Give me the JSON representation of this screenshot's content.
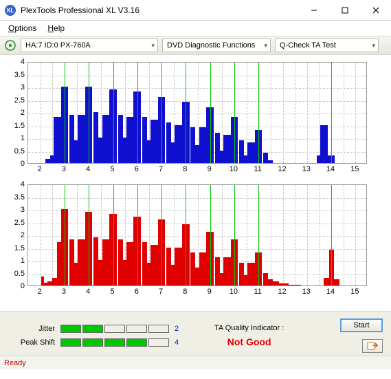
{
  "titlebar": {
    "app_icon_text": "XL",
    "title": "PlexTools Professional XL V3.16"
  },
  "menubar": {
    "options": "Options",
    "help": "Help"
  },
  "toolbar": {
    "drive": "HA:7 ID:0   PX-760A",
    "mode": "DVD Diagnostic Functions",
    "test": "Q-Check TA Test"
  },
  "footer": {
    "jitter_label": "Jitter",
    "jitter_value": "2",
    "peakshift_label": "Peak Shift",
    "peakshift_value": "4",
    "quality_title": "TA Quality Indicator :",
    "quality_value": "Not Good",
    "start_label": "Start"
  },
  "statusbar": {
    "text": "Ready"
  },
  "chart_data": [
    {
      "type": "area",
      "color": "#1010d0",
      "xlabel": "",
      "ylabel": "",
      "x_ticks": [
        2,
        3,
        4,
        5,
        6,
        7,
        8,
        9,
        10,
        11,
        12,
        13,
        14,
        15
      ],
      "y_ticks": [
        0,
        0.5,
        1,
        1.5,
        2,
        2.5,
        3,
        3.5,
        4
      ],
      "xlim": [
        1.5,
        15.5
      ],
      "ylim": [
        0,
        4
      ],
      "green_lines": [
        3,
        4,
        5,
        6,
        7,
        8,
        9,
        10,
        11,
        14
      ],
      "x": [
        2,
        2.1,
        2.3,
        2.5,
        2.7,
        3,
        3.3,
        3.5,
        3.7,
        4,
        4.3,
        4.5,
        4.7,
        5,
        5.3,
        5.5,
        5.7,
        6,
        6.3,
        6.5,
        6.7,
        7,
        7.3,
        7.5,
        7.7,
        8,
        8.3,
        8.5,
        8.7,
        9,
        9.3,
        9.5,
        9.7,
        10,
        10.3,
        10.5,
        10.7,
        11,
        11.3,
        11.5,
        11.7,
        12,
        12.5,
        13,
        13.5,
        13.7,
        14,
        14.3,
        14.5,
        15
      ],
      "values": [
        0,
        0,
        0.15,
        0.3,
        1.8,
        3.0,
        1.9,
        0.9,
        1.9,
        3.0,
        2.0,
        1.0,
        1.9,
        2.9,
        1.9,
        1.0,
        1.8,
        2.8,
        1.8,
        0.9,
        1.7,
        2.6,
        1.6,
        0.8,
        1.5,
        2.4,
        1.4,
        0.7,
        1.4,
        2.2,
        1.2,
        0.5,
        1.1,
        1.8,
        0.9,
        0.3,
        0.8,
        1.3,
        0.4,
        0.1,
        0,
        0,
        0,
        0,
        0.3,
        1.5,
        0.3,
        0,
        0,
        0
      ]
    },
    {
      "type": "area",
      "color": "#e00000",
      "xlabel": "",
      "ylabel": "",
      "x_ticks": [
        2,
        3,
        4,
        5,
        6,
        7,
        8,
        9,
        10,
        11,
        12,
        13,
        14,
        15
      ],
      "y_ticks": [
        0,
        0.5,
        1,
        1.5,
        2,
        2.5,
        3,
        3.5,
        4
      ],
      "xlim": [
        1.5,
        15.5
      ],
      "ylim": [
        0,
        4
      ],
      "green_lines": [
        3,
        4,
        5,
        6,
        7,
        8,
        9,
        10,
        11,
        14
      ],
      "x": [
        2,
        2.1,
        2.2,
        2.4,
        2.6,
        2.8,
        3,
        3.3,
        3.5,
        3.7,
        4,
        4.3,
        4.5,
        4.7,
        5,
        5.3,
        5.5,
        5.7,
        6,
        6.3,
        6.5,
        6.7,
        7,
        7.3,
        7.5,
        7.7,
        8,
        8.3,
        8.5,
        8.7,
        9,
        9.3,
        9.5,
        9.7,
        10,
        10.3,
        10.5,
        10.7,
        11,
        11.3,
        11.5,
        11.7,
        12,
        12.5,
        13,
        13.5,
        13.8,
        14,
        14.2,
        14.5,
        15
      ],
      "values": [
        0,
        0.35,
        0.1,
        0.15,
        0.3,
        1.7,
        3.0,
        1.8,
        0.9,
        1.8,
        2.9,
        1.9,
        1.0,
        1.8,
        2.8,
        1.8,
        1.0,
        1.7,
        2.7,
        1.7,
        0.9,
        1.6,
        2.6,
        1.5,
        0.8,
        1.5,
        2.4,
        1.3,
        0.7,
        1.3,
        2.1,
        1.1,
        0.5,
        1.1,
        1.8,
        0.9,
        0.4,
        0.9,
        1.3,
        0.5,
        0.25,
        0.15,
        0.08,
        0.02,
        0,
        0,
        0.3,
        1.4,
        0.25,
        0,
        0
      ]
    }
  ]
}
